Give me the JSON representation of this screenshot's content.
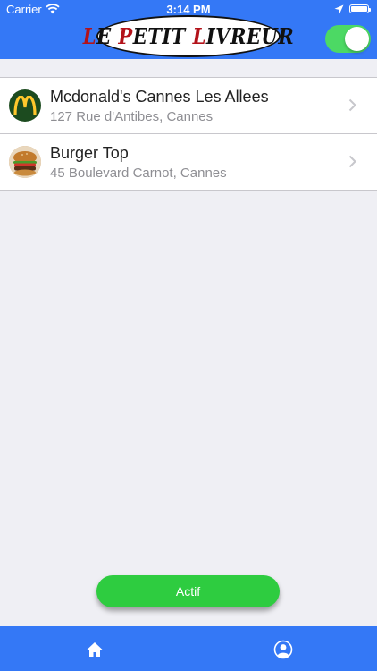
{
  "status_bar": {
    "carrier": "Carrier",
    "time": "3:14 PM",
    "wifi_icon": "wifi-icon",
    "location_icon": "location-arrow-icon",
    "battery_icon": "battery-icon"
  },
  "header": {
    "logo": {
      "first": "L",
      "w1": "E",
      "w2a": "P",
      "w2b": "ETIT",
      "w3a": "L",
      "w3b": "IVREUR"
    },
    "toggle": {
      "on": true,
      "color": "#4cd964"
    },
    "background_color": "#3478f6"
  },
  "restaurants": [
    {
      "name": "Mcdonald's Cannes Les Allees",
      "address": "127 Rue d'Antibes, Cannes",
      "icon": "mcdonalds-logo-icon"
    },
    {
      "name": "Burger Top",
      "address": "45 Boulevard Carnot, Cannes",
      "icon": "burger-photo-icon"
    }
  ],
  "actif_button": {
    "label": "Actif",
    "color": "#2ecc40"
  },
  "tab_bar": {
    "items": [
      {
        "name": "home",
        "icon": "home-icon"
      },
      {
        "name": "profile",
        "icon": "user-icon"
      }
    ],
    "background_color": "#3478f6"
  }
}
